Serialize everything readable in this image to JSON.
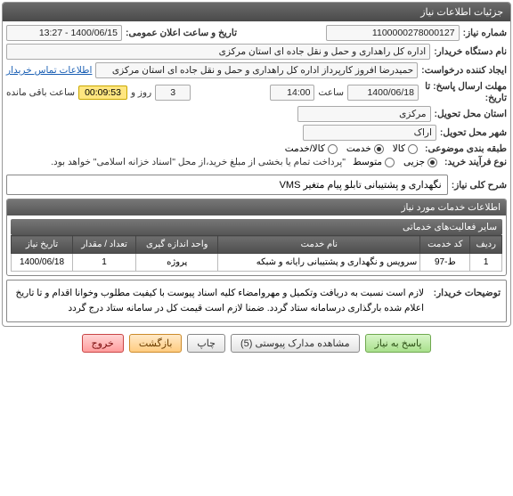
{
  "panel_title": "جزئیات اطلاعات نیاز",
  "rows": {
    "need_no_label": "شماره نیاز:",
    "need_no": "1100000278000127",
    "announce_label": "تاریخ و ساعت اعلان عمومی:",
    "announce_value": "1400/06/15 - 13:27",
    "buyer_org_label": "نام دستگاه خریدار:",
    "buyer_org": "اداره کل راهداری و حمل و نقل جاده ای استان مرکزی",
    "requester_label": "ایجاد کننده درخواست:",
    "requester": "حمیدرضا  افروز  کارپرداز اداره کل راهداری و حمل و نقل جاده ای استان مرکزی",
    "contact_link": "اطلاعات تماس خریدار",
    "deadline_label": "مهلت ارسال پاسخ: تا تاریخ:",
    "deadline_date": "1400/06/18",
    "time_label": "ساعت",
    "deadline_time": "14:00",
    "days": "3",
    "days_label": "روز و",
    "countdown": "00:09:53",
    "remaining_label": "ساعت باقی مانده",
    "province_label": "استان محل تحویل:",
    "province": "مرکزی",
    "city_label": "شهر محل تحویل:",
    "city": "اراک",
    "subject_class_label": "طبقه بندی موضوعی:",
    "radio_goods": "کالا",
    "radio_service": "خدمت",
    "radio_goods_service": "کالا/خدمت",
    "process_type_label": "نوع فرآیند خرید:",
    "radio_partial": "جزیی",
    "radio_medium": "متوسط",
    "process_note": "\"پرداخت تمام یا بخشی از مبلغ خرید،از محل \"اسناد خزانه اسلامی\" خواهد بود.",
    "need_title_label": "شرح کلی نیاز:",
    "need_title": "نگهداری و پشتیبانی تابلو پیام متغیر VMS"
  },
  "services_panel": "اطلاعات خدمات مورد نیاز",
  "activities_header": "سایر فعالیت‌های خدماتی",
  "table": {
    "headers": [
      "ردیف",
      "کد خدمت",
      "نام خدمت",
      "واحد اندازه گیری",
      "تعداد / مقدار",
      "تاریخ نیاز"
    ],
    "row": [
      "1",
      "ط-97",
      "سرویس و نگهداری و پشتیبانی رایانه و شبکه",
      "پروژه",
      "1",
      "1400/06/18"
    ]
  },
  "buyer_notes_label": "توضیحات خریدار:",
  "buyer_notes": "لازم است نسبت به دریافت وتکمیل و مهروامضاء کلیه اسناد پیوست با کیفیت مطلوب وخوانا اقدام و تا تاریخ اعلام شده بارگذاری درسامانه ستاد گردد. ضمنا لازم است قیمت کل در سامانه ستاد درج گردد",
  "buttons": {
    "respond": "پاسخ به نیاز",
    "attachments": "مشاهده مدارک پیوستی  (5)",
    "print": "چاپ",
    "back": "بازگشت",
    "exit": "خروج"
  }
}
